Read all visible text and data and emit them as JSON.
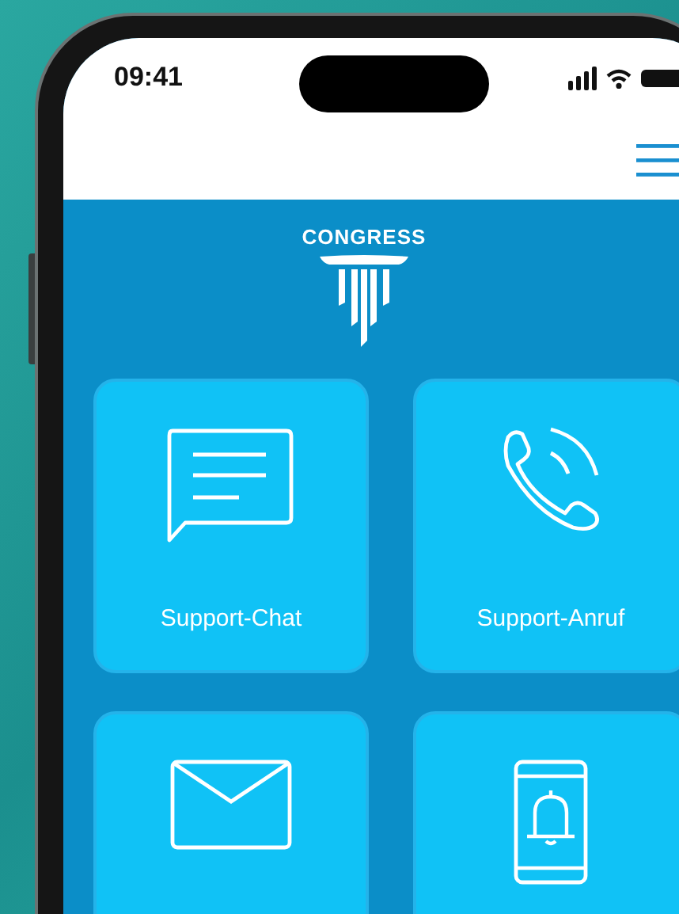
{
  "status_bar": {
    "time": "09:41"
  },
  "brand": {
    "name": "CONGRESS"
  },
  "tiles": [
    {
      "kind": "chat",
      "label": "Support-Chat"
    },
    {
      "kind": "phone",
      "label": "Support-Anruf"
    },
    {
      "kind": "mail"
    },
    {
      "kind": "alert"
    }
  ]
}
